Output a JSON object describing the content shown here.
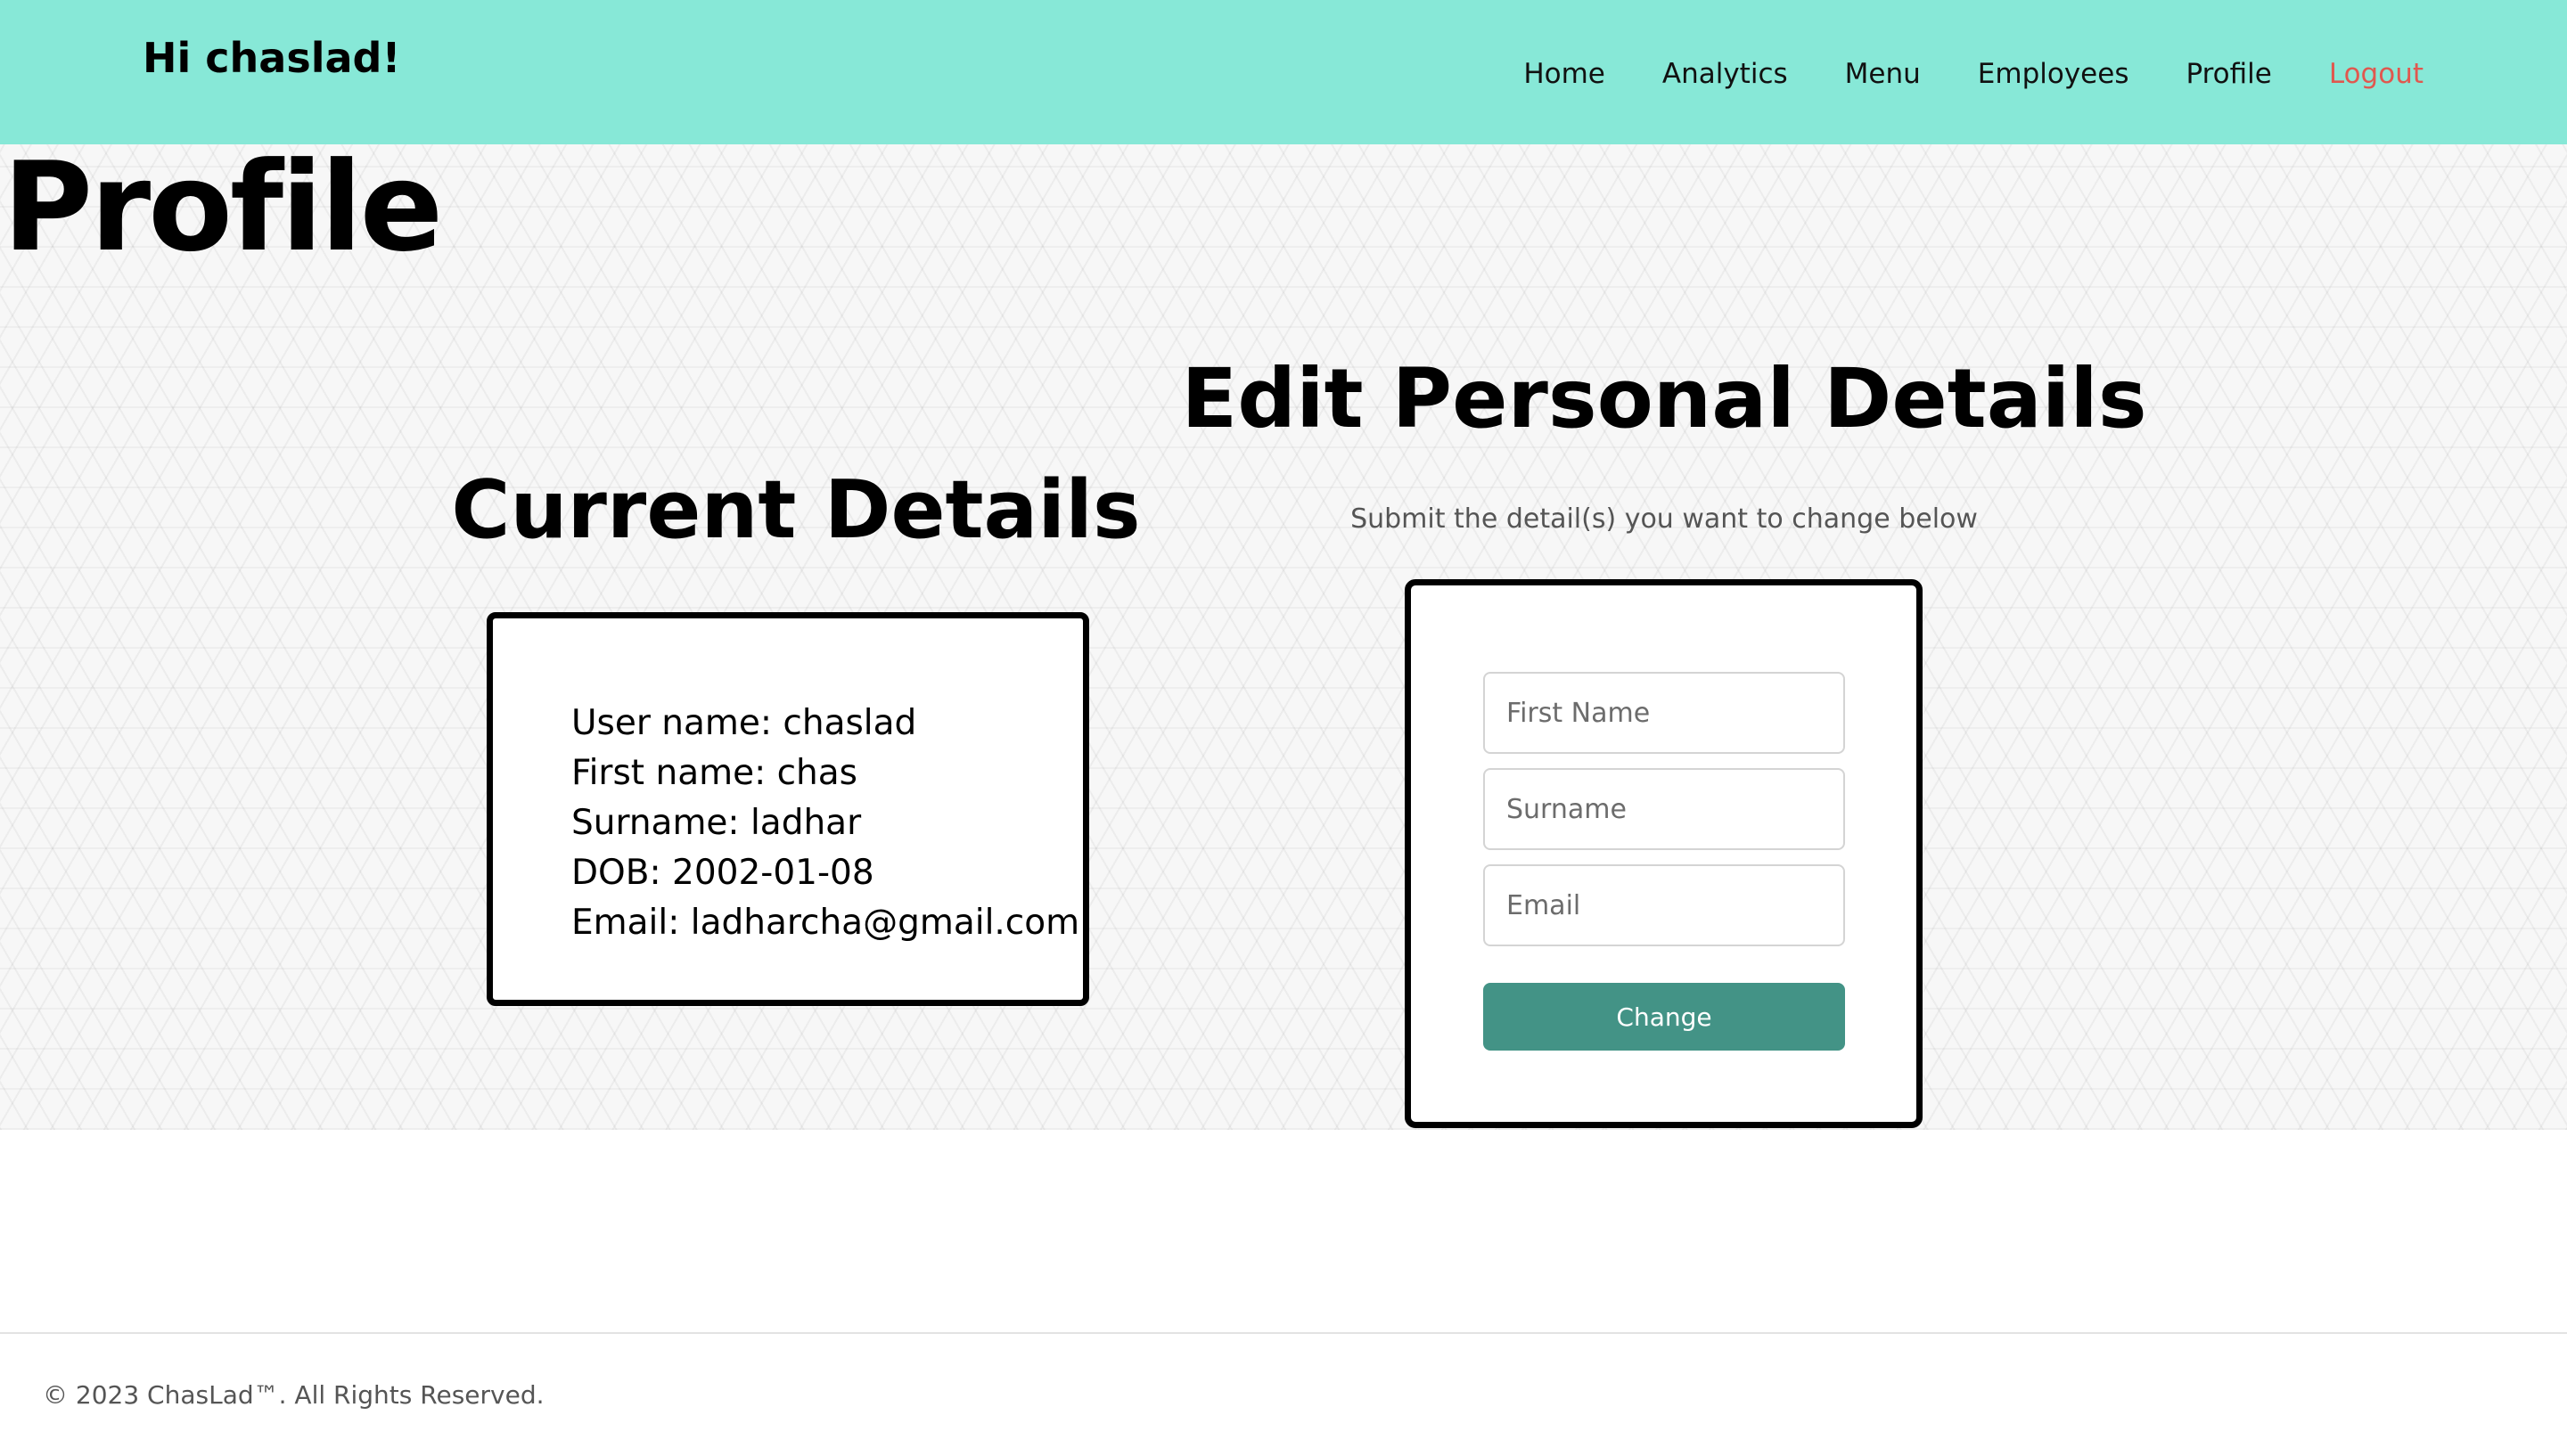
{
  "header": {
    "greeting": "Hi chaslad!",
    "nav": {
      "home": "Home",
      "analytics": "Analytics",
      "menu": "Menu",
      "employees": "Employees",
      "profile": "Profile",
      "logout": "Logout"
    },
    "background_color": "#87e8d7",
    "logout_color": "#e0584f"
  },
  "page": {
    "title": "Profile"
  },
  "current_details": {
    "heading": "Current Details",
    "user_name": "User name: chaslad",
    "first_name": "First name: chas",
    "surname": "Surname: ladhar",
    "dob": "DOB: 2002-01-08",
    "email": "Email: ladharcha@gmail.com"
  },
  "edit_details": {
    "heading": "Edit Personal Details",
    "subtitle": "Submit the detail(s) you want to change below",
    "first_name_placeholder": "First Name",
    "surname_placeholder": "Surname",
    "email_placeholder": "Email",
    "first_name_value": "",
    "surname_value": "",
    "email_value": "",
    "button_label": "Change",
    "button_color": "#439386"
  },
  "footer": {
    "copyright": "© 2023 ChasLad™. All Rights Reserved."
  }
}
